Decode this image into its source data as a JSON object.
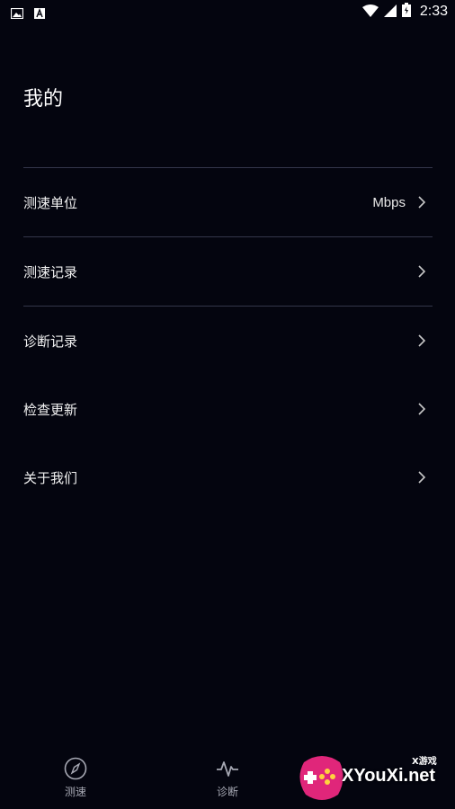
{
  "status_bar": {
    "time": "2:33",
    "icons": [
      "image-icon",
      "font-icon",
      "wifi-icon",
      "signal-icon",
      "battery-icon"
    ]
  },
  "page": {
    "title": "我的"
  },
  "menu": {
    "items": [
      {
        "label": "测速单位",
        "value": "Mbps"
      },
      {
        "label": "测速记录"
      },
      {
        "label": "诊断记录"
      },
      {
        "label": "检查更新"
      },
      {
        "label": "关于我们"
      }
    ]
  },
  "bottom_nav": {
    "items": [
      {
        "label": "测速",
        "icon": "compass-icon"
      },
      {
        "label": "诊断",
        "icon": "pulse-icon"
      }
    ]
  },
  "watermark": {
    "text": "XYouXi.net",
    "small": "X游戏"
  },
  "colors": {
    "background": "#04050f",
    "divider": "#34364a",
    "nav_label": "#a6a8b3"
  }
}
